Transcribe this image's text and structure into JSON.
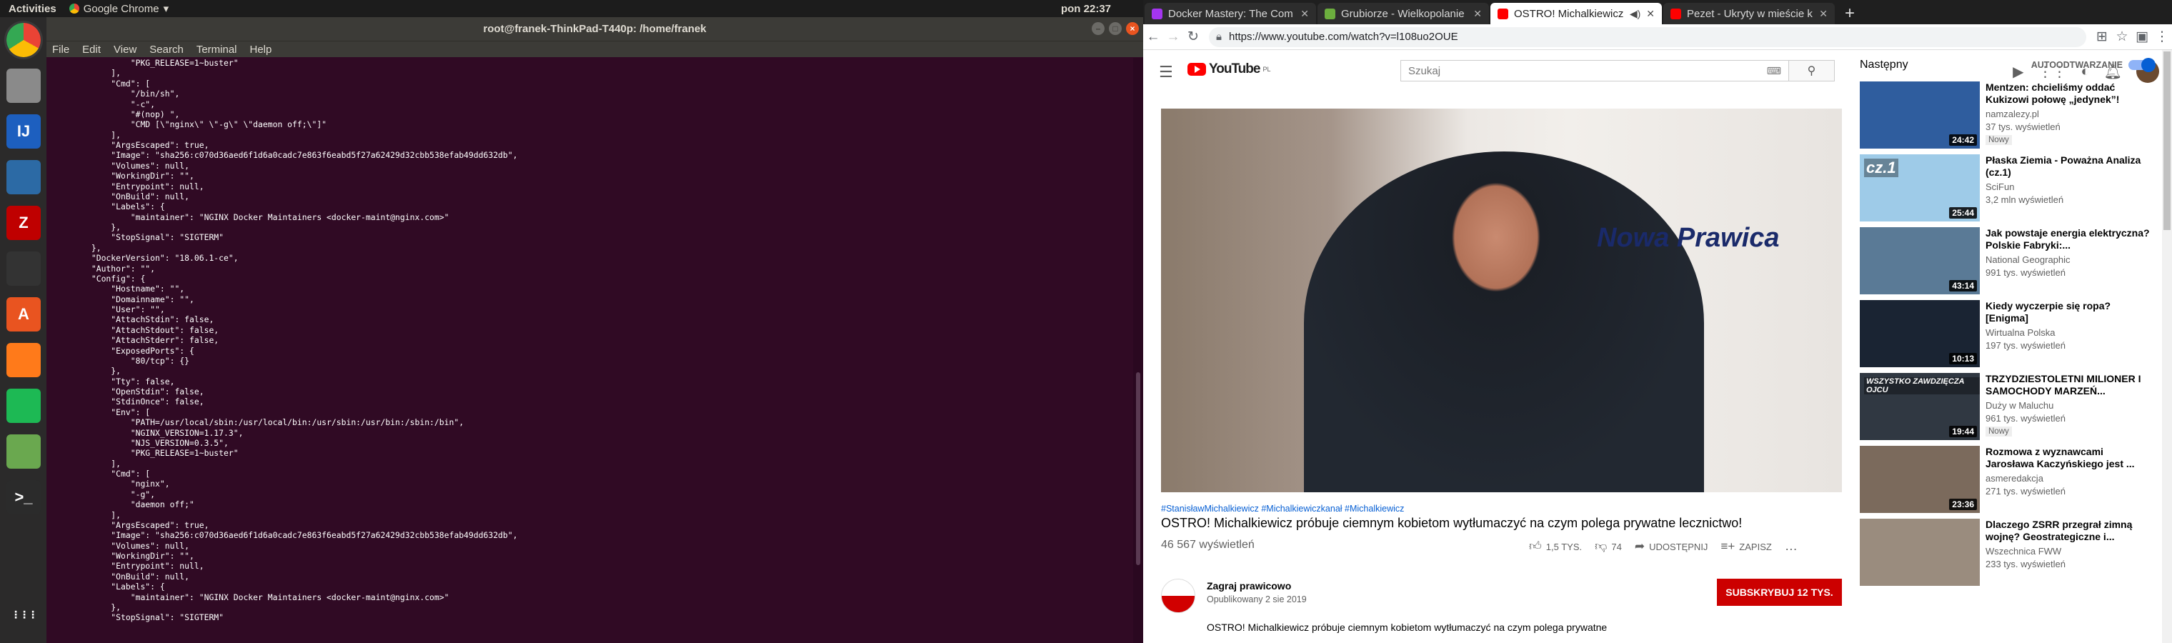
{
  "topbar": {
    "activities": "Activities",
    "app_name": "Google Chrome",
    "app_arrow": "▾",
    "clock": "pon 22:37"
  },
  "dock": {
    "items": [
      {
        "name": "chrome-icon",
        "glyph": "",
        "color": "#e8453c"
      },
      {
        "name": "files-icon",
        "glyph": "",
        "color": "#8a8a8a"
      },
      {
        "name": "intellij-icon",
        "glyph": "IJ",
        "color": "#1d5fbf"
      },
      {
        "name": "mysql-workbench-icon",
        "glyph": "",
        "color": "#2c6aa5"
      },
      {
        "name": "filezilla-icon",
        "glyph": "Z",
        "color": "#bf0000"
      },
      {
        "name": "system-monitor-icon",
        "glyph": "",
        "color": "#333"
      },
      {
        "name": "software-center-icon",
        "glyph": "A",
        "color": "#e95420"
      },
      {
        "name": "firefox-icon",
        "glyph": "",
        "color": "#ff7a1a"
      },
      {
        "name": "spotify-icon",
        "glyph": "",
        "color": "#1db954"
      },
      {
        "name": "image-viewer-icon",
        "glyph": "",
        "color": "#6aa84f"
      },
      {
        "name": "terminal-icon",
        "glyph": ">_",
        "color": "#2b2b2b"
      },
      {
        "name": "app-grid-icon",
        "glyph": "⋮⋮⋮",
        "color": "transparent"
      }
    ]
  },
  "terminal": {
    "title": "root@franek-ThinkPad-T440p: /home/franek",
    "menu": [
      "File",
      "Edit",
      "View",
      "Search",
      "Terminal",
      "Help"
    ],
    "lines": [
      "                \"PKG_RELEASE=1~buster\"",
      "            ],",
      "            \"Cmd\": [",
      "                \"/bin/sh\",",
      "                \"-c\",",
      "                \"#(nop) \",",
      "                \"CMD [\\\"nginx\\\" \\\"-g\\\" \\\"daemon off;\\\"]\"",
      "            ],",
      "            \"ArgsEscaped\": true,",
      "            \"Image\": \"sha256:c070d36aed6f1d6a0cadc7e863f6eabd5f27a62429d32cbb538efab49dd632db\",",
      "            \"Volumes\": null,",
      "            \"WorkingDir\": \"\",",
      "            \"Entrypoint\": null,",
      "            \"OnBuild\": null,",
      "            \"Labels\": {",
      "                \"maintainer\": \"NGINX Docker Maintainers <docker-maint@nginx.com>\"",
      "            },",
      "            \"StopSignal\": \"SIGTERM\"",
      "        },",
      "        \"DockerVersion\": \"18.06.1-ce\",",
      "        \"Author\": \"\",",
      "        \"Config\": {",
      "            \"Hostname\": \"\",",
      "            \"Domainname\": \"\",",
      "            \"User\": \"\",",
      "            \"AttachStdin\": false,",
      "            \"AttachStdout\": false,",
      "            \"AttachStderr\": false,",
      "            \"ExposedPorts\": {",
      "                \"80/tcp\": {}",
      "            },",
      "            \"Tty\": false,",
      "            \"OpenStdin\": false,",
      "            \"StdinOnce\": false,",
      "            \"Env\": [",
      "                \"PATH=/usr/local/sbin:/usr/local/bin:/usr/sbin:/usr/bin:/sbin:/bin\",",
      "                \"NGINX_VERSION=1.17.3\",",
      "                \"NJS_VERSION=0.3.5\",",
      "                \"PKG_RELEASE=1~buster\"",
      "            ],",
      "            \"Cmd\": [",
      "                \"nginx\",",
      "                \"-g\",",
      "                \"daemon off;\"",
      "            ],",
      "            \"ArgsEscaped\": true,",
      "            \"Image\": \"sha256:c070d36aed6f1d6a0cadc7e863f6eabd5f27a62429d32cbb538efab49dd632db\",",
      "            \"Volumes\": null,",
      "            \"WorkingDir\": \"\",",
      "            \"Entrypoint\": null,",
      "            \"OnBuild\": null,",
      "            \"Labels\": {",
      "                \"maintainer\": \"NGINX Docker Maintainers <docker-maint@nginx.com>\"",
      "            },",
      "            \"StopSignal\": \"SIGTERM\""
    ]
  },
  "chrome": {
    "tabs": [
      {
        "title": "Docker Mastery: The Com",
        "favicon_color": "#a435f0",
        "active": false
      },
      {
        "title": "Grubiorze - Wielkopolanie",
        "favicon_color": "#6cae3e",
        "active": false
      },
      {
        "title": "OSTRO! Michalkiewicz",
        "favicon_color": "#ff0000",
        "active": true
      },
      {
        "title": "Pezet - Ukryty w mieście k",
        "favicon_color": "#ff0000",
        "active": false
      }
    ],
    "new_tab": "+",
    "url": "https://www.youtube.com/watch?v=l108uo2OUE"
  },
  "youtube": {
    "logo_text": "YouTube",
    "logo_region": "PL",
    "search_placeholder": "Szukaj",
    "video": {
      "tags": "#StanisławMichalkiewicz #Michalkiewiczkanał #Michalkiewicz",
      "title": "OSTRO! Michalkiewicz próbuje ciemnym kobietom wytłumaczyć na czym polega prywatne lecznictwo!",
      "views": "46 567 wyświetleń",
      "likes": "1,5 TYS.",
      "dislikes": "74",
      "share": "UDOSTĘPNIJ",
      "save": "ZAPISZ",
      "more": "…",
      "player_logo": "Nowa Prawica"
    },
    "channel": {
      "name": "Zagraj prawicowo",
      "published": "Opublikowany 2 sie 2019",
      "subscribe": "SUBSKRYBUJ  12 TYS."
    },
    "description": "OSTRO! Michalkiewicz próbuje ciemnym kobietom wytłumaczyć na czym polega prywatne",
    "sidebar": {
      "up_next": "Następny",
      "autoplay": "AUTOODTWARZANIE",
      "autoplay_on": true,
      "items": [
        {
          "title": "Mentzen: chcieliśmy oddać Kukizowi połowę „jedynek”!",
          "channel": "namzalezy.pl",
          "views": "37 tys. wyświetleń",
          "badge": "Nowy",
          "duration": "24:42",
          "thumb": "#2f5d9e"
        },
        {
          "title": "Płaska Ziemia - Poważna Analiza (cz.1)",
          "channel": "SciFun",
          "views": "3,2 mln wyświetleń",
          "badge": "",
          "duration": "25:44",
          "thumb_text": "cz.1",
          "thumb": "#9ecbe8"
        },
        {
          "title": "Jak powstaje energia elektryczna? Polskie Fabryki:...",
          "channel": "National Geographic",
          "views": "991 tys. wyświetleń",
          "badge": "",
          "duration": "43:14",
          "thumb": "#5a7a96"
        },
        {
          "title": "Kiedy wyczerpie się ropa? [Enigma]",
          "channel": "Wirtualna Polska",
          "views": "197 tys. wyświetleń",
          "badge": "",
          "duration": "10:13",
          "thumb": "#1a2433"
        },
        {
          "title": "TRZYDZIESTOLETNI MILIONER I SAMOCHODY MARZEŃ...",
          "channel": "Duży w Maluchu",
          "views": "961 tys. wyświetleń",
          "badge": "Nowy",
          "duration": "19:44",
          "thumb_text": "WSZYSTKO ZAWDZIĘCZA OJCU",
          "thumb": "#303842"
        },
        {
          "title": "Rozmowa z wyznawcami Jarosława Kaczyńskiego jest ...",
          "channel": "asmeredakcja",
          "views": "271 tys. wyświetleń",
          "badge": "",
          "duration": "23:36",
          "thumb": "#7b6a5c"
        },
        {
          "title": "Dlaczego ZSRR przegrał zimną wojnę? Geostrategiczne i...",
          "channel": "Wszechnica FWW",
          "views": "233 tys. wyświetleń",
          "badge": "",
          "duration": "",
          "thumb": "#9a8c7e"
        }
      ]
    }
  }
}
